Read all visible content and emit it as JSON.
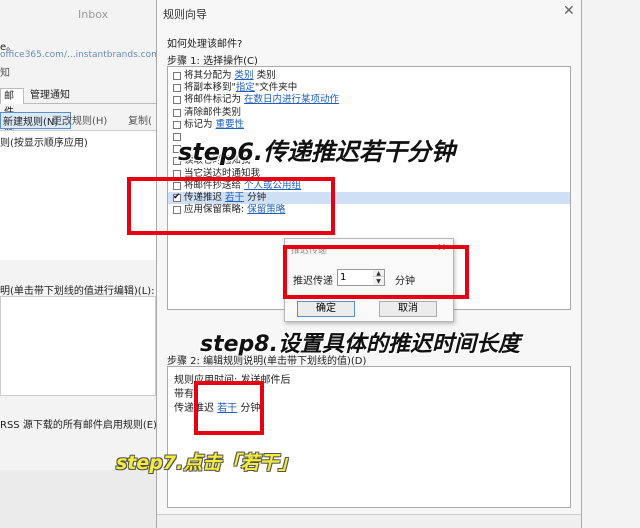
{
  "background_window": {
    "title": "Inbox",
    "line1": "e。",
    "line2": "office365.com/...instantbrands.com",
    "line3": "知",
    "tabs": [
      "邮件规则",
      "管理通知"
    ],
    "toolbar": {
      "new_rule": "新建规则(N)...",
      "change_rule": "更改规则(H)",
      "copy": "复制("
    },
    "rule_list_header": "则(按显示顺序应用)",
    "desc_label": "明(单击带下划线的值进行编辑)(L):",
    "rss_text": "RSS 源下载的所有邮件启用规则(E)"
  },
  "wizard": {
    "title": "规则向导",
    "close_glyph": "✕",
    "question": "如何处理该邮件?",
    "step1_label": "步骤 1: 选择操作(C)",
    "actions": [
      {
        "prefix": "将其分配为 ",
        "link": "类别",
        "suffix": " 类别",
        "checked": false,
        "selected": false
      },
      {
        "prefix": "将副本移到\"",
        "link": "指定",
        "suffix": "\"文件夹中",
        "checked": false,
        "selected": false
      },
      {
        "prefix": "将邮件标记为 ",
        "link": "在数日内进行某项动作",
        "suffix": "",
        "checked": false,
        "selected": false
      },
      {
        "prefix": "清除邮件类别",
        "link": "",
        "suffix": "",
        "checked": false,
        "selected": false
      },
      {
        "prefix": "标记为 ",
        "link": "重要性",
        "suffix": "",
        "checked": false,
        "selected": false
      },
      {
        "prefix": "",
        "link": "",
        "suffix": "",
        "checked": false,
        "selected": false
      },
      {
        "prefix": "",
        "link": "",
        "suffix": "",
        "checked": false,
        "selected": false
      },
      {
        "prefix": "读取它时通知我",
        "link": "",
        "suffix": "",
        "checked": false,
        "selected": false
      },
      {
        "prefix": "当它送达时通知我",
        "link": "",
        "suffix": "",
        "checked": false,
        "selected": false
      },
      {
        "prefix": "将邮件抄送给 ",
        "link": "个人或公用组",
        "suffix": "",
        "checked": false,
        "selected": false
      },
      {
        "prefix": "传递推迟 ",
        "link": "若干",
        "suffix": " 分钟",
        "checked": true,
        "selected": true
      },
      {
        "prefix": "应用保留策略: ",
        "link": "保留策略",
        "suffix": "",
        "checked": false,
        "selected": false
      }
    ],
    "step2_label": "步骤 2: 编辑规则说明(单击带下划线的值)(D)",
    "description": {
      "line1": "规则应用时间: 发送邮件后",
      "line2": "带有 ",
      "line3_prefix": "传递推迟 ",
      "line3_link": "若干",
      "line3_suffix": " 分钟"
    }
  },
  "defer_dialog": {
    "title": "推迟传递",
    "close_glyph": "✕",
    "label": "推迟传递",
    "value": "1",
    "unit": "分钟",
    "ok": "确定",
    "cancel": "取消"
  },
  "annotations": {
    "step6": "step6.传递推迟若干分钟",
    "step7": "step7.点击「若干」",
    "step8": "step8.设置具体的推迟时间长度",
    "box_color": "#e60012"
  }
}
